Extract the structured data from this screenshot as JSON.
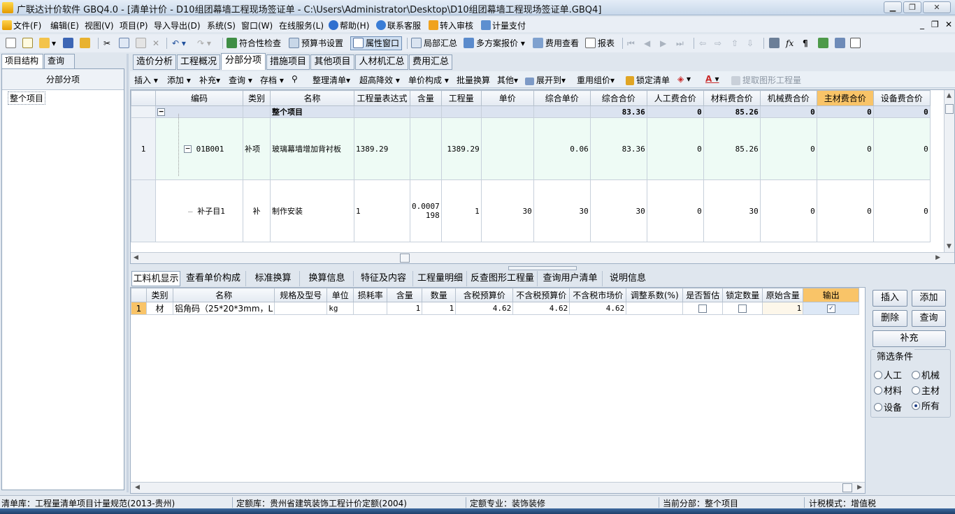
{
  "window": {
    "title": "广联达计价软件 GBQ4.0 - [清单计价 - D10组团幕墙工程现场签证单 - C:\\Users\\Administrator\\Desktop\\D10组团幕墙工程现场签证单.GBQ4]",
    "min": "▁",
    "max": "❐",
    "close": "✕"
  },
  "menu": {
    "items": [
      "文件(F)",
      "编辑(E)",
      "视图(V)",
      "项目(P)",
      "导入导出(D)",
      "系统(S)",
      "窗口(W)",
      "在线服务(L)",
      "帮助(H)",
      "联系客服",
      "转入审核",
      "计量支付"
    ],
    "mdi_min": "_",
    "mdi_restore": "❐",
    "mdi_close": "✕"
  },
  "toolbar": {
    "check": "符合性检查",
    "budget_settings": "预算书设置",
    "property_window": "属性窗口",
    "local_summary": "局部汇总",
    "multi_quote": "多方案报价",
    "fee_view": "费用查看",
    "report": "报表"
  },
  "left": {
    "tabs": [
      "项目结构",
      "查询"
    ],
    "header": "分部分项",
    "tree_item": "整个项目"
  },
  "main_tabs": [
    "造价分析",
    "工程概况",
    "分部分项",
    "措施项目",
    "其他项目",
    "人材机汇总",
    "费用汇总"
  ],
  "subtoolbar": {
    "insert": "插入",
    "add": "添加",
    "supplement": "补充",
    "query": "查询",
    "save": "存档",
    "tidy_list": "整理清单",
    "super_reduce": "超高降效",
    "unit_price_comp": "单价构成",
    "batch_convert": "批量换算",
    "other": "其他",
    "expand_to": "展开到",
    "reuse_price": "重用组价",
    "lock_list": "锁定清单",
    "extract": "提取图形工程量"
  },
  "grid": {
    "headers": [
      "",
      "编码",
      "类别",
      "名称",
      "工程量表达式",
      "含量",
      "工程量",
      "单价",
      "综合单价",
      "综合合价",
      "人工费合价",
      "材料费合价",
      "机械费合价",
      "主材费合价",
      "设备费合价"
    ],
    "project_row": {
      "name": "整个项目",
      "comp_total": "83.36",
      "labor": "0",
      "material": "85.26",
      "machine": "0",
      "main_material": "0",
      "equipment": "0"
    },
    "list_row": {
      "no": "1",
      "code": "01B001",
      "type": "补项",
      "name": "玻璃幕墙增加背衬板",
      "expr": "1389.29",
      "content": "",
      "qty": "1389.29",
      "price": "",
      "comp_price": "0.06",
      "comp_total": "83.36",
      "labor": "0",
      "material": "85.26",
      "machine": "0",
      "main_material": "0",
      "equipment": "0"
    },
    "sub_row": {
      "no": "",
      "code": "补子目1",
      "type": "补",
      "name": "制作安装",
      "expr": "1",
      "content_line1": "0.0007",
      "content_line2": "198",
      "qty": "1",
      "price": "30",
      "comp_price": "30",
      "comp_total": "30",
      "labor": "0",
      "material": "30",
      "machine": "0",
      "main_material": "0",
      "equipment": "0"
    }
  },
  "bottom_tabs": [
    "工料机显示",
    "查看单价构成",
    "标准换算",
    "换算信息",
    "特征及内容",
    "工程量明细",
    "反查图形工程量",
    "查询用户清单",
    "说明信息"
  ],
  "lower_grid": {
    "headers": [
      "",
      "类别",
      "名称",
      "规格及型号",
      "单位",
      "损耗率",
      "含量",
      "数量",
      "含税预算价",
      "不含税预算价",
      "不含税市场价",
      "调整系数(%)",
      "是否暂估",
      "锁定数量",
      "原始含量",
      "输出"
    ],
    "rows": [
      {
        "no": "1",
        "type": "材",
        "name": "铝角码（25*20*3mm，L",
        "spec": "",
        "unit": "kg",
        "loss": "",
        "content": "1",
        "qty": "1",
        "tax_budget": "4.62",
        "notax_budget": "4.62",
        "notax_market": "4.62",
        "adjust": "",
        "provisional": false,
        "lock_qty": false,
        "orig_content": "1",
        "output": true
      }
    ]
  },
  "right_buttons": {
    "insert": "插入",
    "add": "添加",
    "delete": "删除",
    "query": "查询",
    "supplement": "补充"
  },
  "filter": {
    "title": "筛选条件",
    "options": [
      "人工",
      "机械",
      "材料",
      "主材",
      "设备",
      "所有"
    ],
    "selected": "所有"
  },
  "status": {
    "list_lib": "清单库：工程量清单项目计量规范(2013-贵州)",
    "quota_lib": "定额库：贵州省建筑装饰工程计价定额(2004)",
    "quota_major": "定额专业：装饰装修",
    "current_part": "当前分部：整个项目",
    "tax_mode": "计税模式：增值税"
  },
  "colors": {
    "highlight_header": "#f9c468",
    "list_row_bg": "#eefbf5",
    "project_row_bg": "#dbe3f0"
  }
}
